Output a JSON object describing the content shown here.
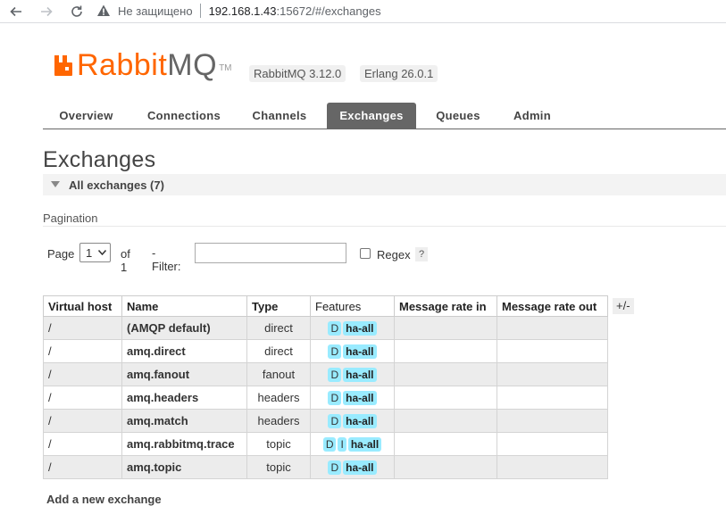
{
  "browser": {
    "security_label": "Не защищено",
    "url_host": "192.168.1.43",
    "url_rest": ":15672/#/exchanges"
  },
  "header": {
    "logo_rabbit": "Rabbit",
    "logo_mq": "MQ",
    "logo_tm": "TM",
    "logo_color": "#ff6600",
    "rabbitmq_version": "RabbitMQ 3.12.0",
    "erlang_version": "Erlang 26.0.1"
  },
  "tabs": [
    {
      "label": "Overview",
      "active": false
    },
    {
      "label": "Connections",
      "active": false
    },
    {
      "label": "Channels",
      "active": false
    },
    {
      "label": "Exchanges",
      "active": true
    },
    {
      "label": "Queues",
      "active": false
    },
    {
      "label": "Admin",
      "active": false
    }
  ],
  "page_title": "Exchanges",
  "section_title": "All exchanges (7)",
  "pagination": {
    "label": "Pagination",
    "page_label": "Page",
    "page_value": "1",
    "of_label": "of 1",
    "filter_label": "- Filter:",
    "filter_value": "",
    "regex_label": "Regex",
    "regex_checked": false,
    "help": "?"
  },
  "table": {
    "columns": [
      "Virtual host",
      "Name",
      "Type",
      "Features",
      "Message rate in",
      "Message rate out"
    ],
    "plus_minus": "+/-",
    "rows": [
      {
        "vhost": "/",
        "name": "(AMQP default)",
        "type": "direct",
        "features": [
          "D",
          "ha-all"
        ]
      },
      {
        "vhost": "/",
        "name": "amq.direct",
        "type": "direct",
        "features": [
          "D",
          "ha-all"
        ]
      },
      {
        "vhost": "/",
        "name": "amq.fanout",
        "type": "fanout",
        "features": [
          "D",
          "ha-all"
        ]
      },
      {
        "vhost": "/",
        "name": "amq.headers",
        "type": "headers",
        "features": [
          "D",
          "ha-all"
        ]
      },
      {
        "vhost": "/",
        "name": "amq.match",
        "type": "headers",
        "features": [
          "D",
          "ha-all"
        ]
      },
      {
        "vhost": "/",
        "name": "amq.rabbitmq.trace",
        "type": "topic",
        "features": [
          "D",
          "I",
          "ha-all"
        ]
      },
      {
        "vhost": "/",
        "name": "amq.topic",
        "type": "topic",
        "features": [
          "D",
          "ha-all"
        ]
      }
    ]
  },
  "add_section": "Add a new exchange",
  "colors": {
    "feature_tag": "#99ebff",
    "active_tab": "#666666"
  }
}
